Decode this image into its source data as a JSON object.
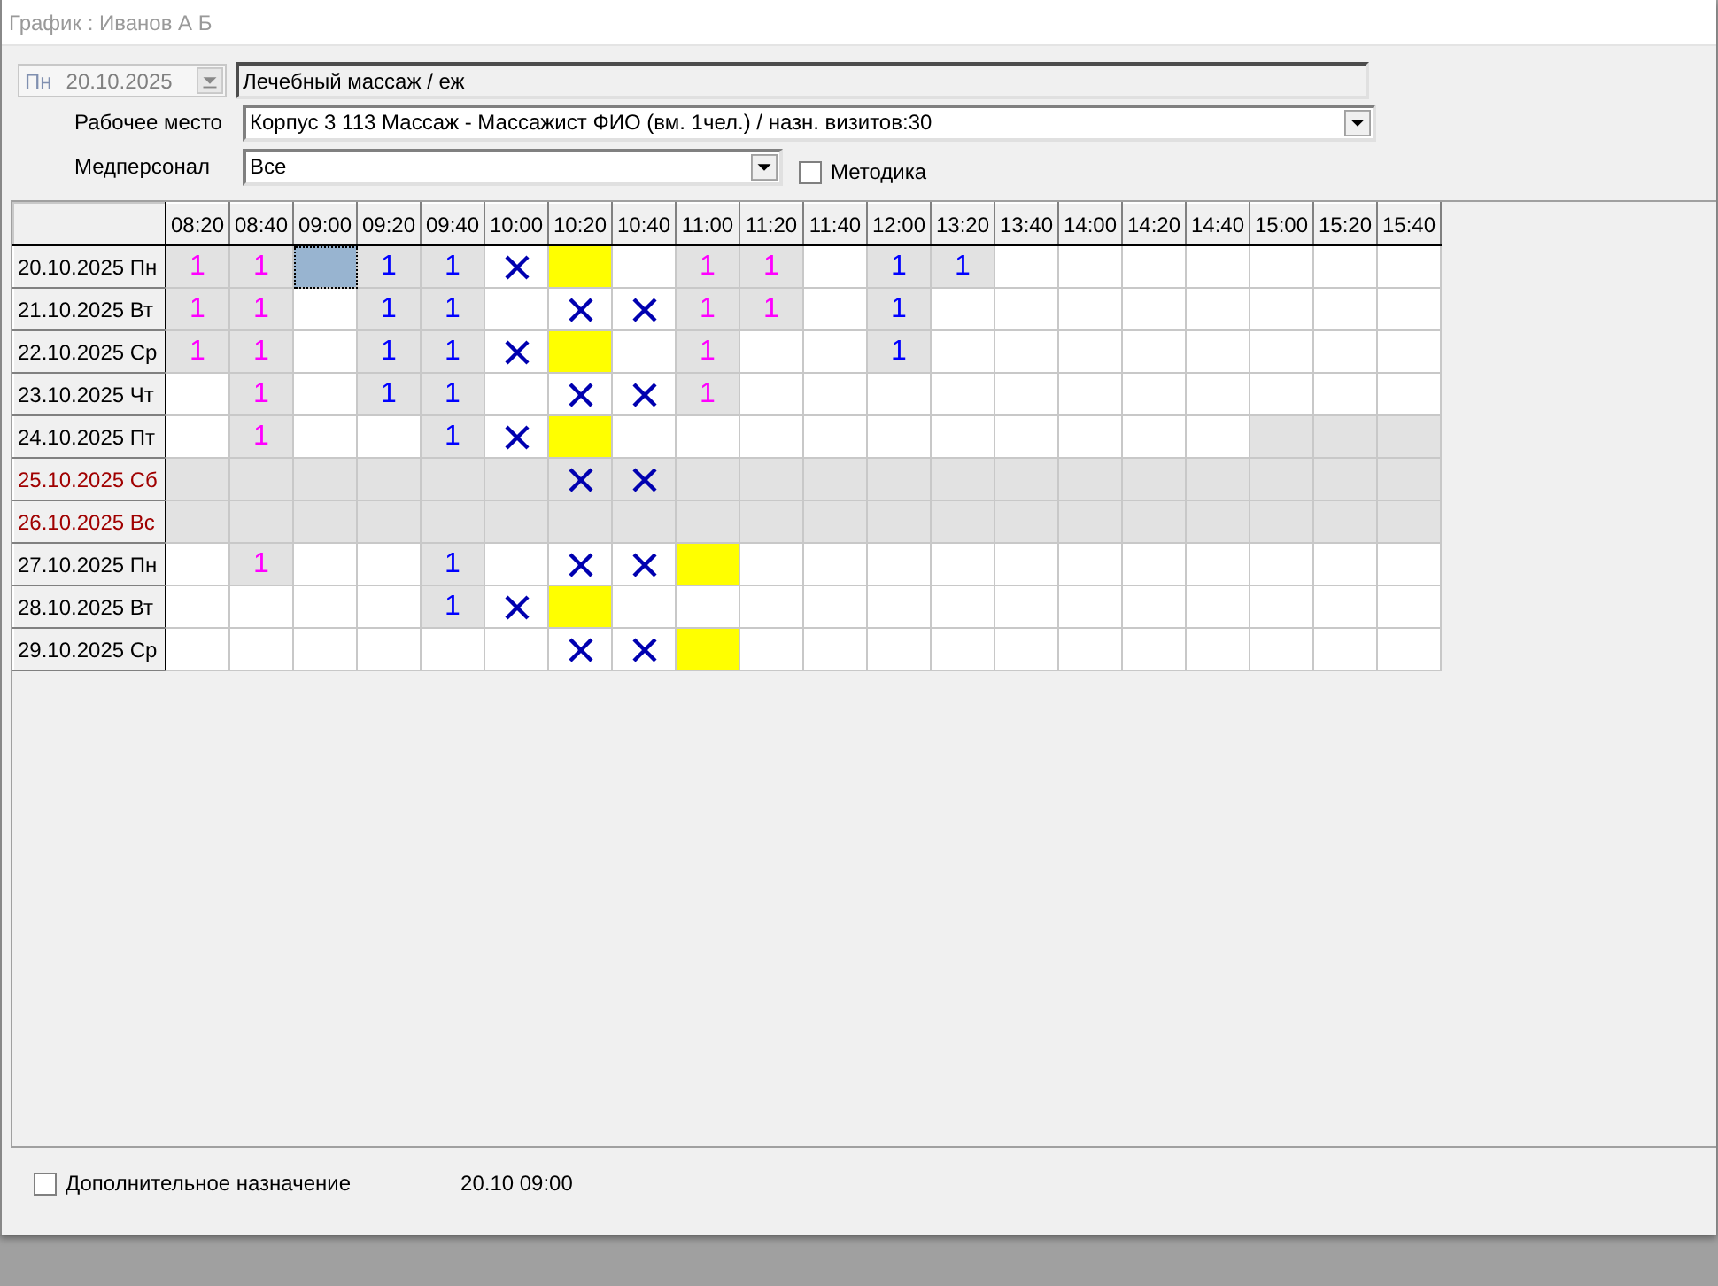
{
  "window": {
    "title": "График : Иванов А Б"
  },
  "date_picker": {
    "day": "Пн",
    "value": "20.10.2025",
    "disabled": true
  },
  "service_field": {
    "value": "Лечебный массаж / еж"
  },
  "workplace": {
    "label": "Рабочее место",
    "value": "Корпус 3 113 Массаж - Массажист ФИО  (вм. 1чел.) / назн. визитов:30"
  },
  "staff": {
    "label": "Медперсонал",
    "value": "Все"
  },
  "method_checkbox": {
    "label": "Методика",
    "checked": false
  },
  "grid": {
    "columns": [
      "08:20",
      "08:40",
      "09:00",
      "09:20",
      "09:40",
      "10:00",
      "10:20",
      "10:40",
      "11:00",
      "11:20",
      "11:40",
      "12:00",
      "13:20",
      "13:40",
      "14:00",
      "14:20",
      "14:40",
      "15:00",
      "15:20",
      "15:40"
    ],
    "rows": [
      {
        "date": "20.10.2025 Пн",
        "weekend": false,
        "cells": [
          {
            "kind": "count",
            "text": "1",
            "color": "#ff00ff",
            "shaded": true,
            "selected": false
          },
          {
            "kind": "count",
            "text": "1",
            "color": "#ff00ff",
            "shaded": true,
            "selected": false
          },
          {
            "kind": "free",
            "shaded": false,
            "selected": true
          },
          {
            "kind": "count",
            "text": "1",
            "color": "#0000ff",
            "shaded": true,
            "selected": false
          },
          {
            "kind": "count",
            "text": "1",
            "color": "#0000ff",
            "shaded": true,
            "selected": false
          },
          {
            "kind": "cross",
            "shaded": false,
            "selected": false
          },
          {
            "kind": "fill",
            "color": "#ffff00",
            "shaded": false,
            "selected": false
          },
          {
            "kind": "free",
            "shaded": false,
            "selected": false
          },
          {
            "kind": "count",
            "text": "1",
            "color": "#ff00ff",
            "shaded": true,
            "selected": false
          },
          {
            "kind": "count",
            "text": "1",
            "color": "#ff00ff",
            "shaded": true,
            "selected": false
          },
          {
            "kind": "free",
            "shaded": false,
            "selected": false
          },
          {
            "kind": "count",
            "text": "1",
            "color": "#0000ff",
            "shaded": true,
            "selected": false
          },
          {
            "kind": "count",
            "text": "1",
            "color": "#0000ff",
            "shaded": true,
            "selected": false
          },
          {
            "kind": "free",
            "shaded": false,
            "selected": false
          },
          {
            "kind": "free",
            "shaded": false,
            "selected": false
          },
          {
            "kind": "free",
            "shaded": false,
            "selected": false
          },
          {
            "kind": "free",
            "shaded": false,
            "selected": false
          },
          {
            "kind": "free",
            "shaded": false,
            "selected": false
          },
          {
            "kind": "free",
            "shaded": false,
            "selected": false
          },
          {
            "kind": "free",
            "shaded": false,
            "selected": false
          }
        ]
      },
      {
        "date": "21.10.2025 Вт",
        "weekend": false,
        "cells": [
          {
            "kind": "count",
            "text": "1",
            "color": "#ff00ff",
            "shaded": true,
            "selected": false
          },
          {
            "kind": "count",
            "text": "1",
            "color": "#ff00ff",
            "shaded": true,
            "selected": false
          },
          {
            "kind": "free",
            "shaded": false,
            "selected": false
          },
          {
            "kind": "count",
            "text": "1",
            "color": "#0000ff",
            "shaded": true,
            "selected": false
          },
          {
            "kind": "count",
            "text": "1",
            "color": "#0000ff",
            "shaded": true,
            "selected": false
          },
          {
            "kind": "free",
            "shaded": false,
            "selected": false
          },
          {
            "kind": "cross",
            "shaded": false,
            "selected": false
          },
          {
            "kind": "cross",
            "shaded": false,
            "selected": false
          },
          {
            "kind": "count",
            "text": "1",
            "color": "#ff00ff",
            "shaded": true,
            "selected": false
          },
          {
            "kind": "count",
            "text": "1",
            "color": "#ff00ff",
            "shaded": true,
            "selected": false
          },
          {
            "kind": "free",
            "shaded": false,
            "selected": false
          },
          {
            "kind": "count",
            "text": "1",
            "color": "#0000ff",
            "shaded": true,
            "selected": false
          },
          {
            "kind": "free",
            "shaded": false,
            "selected": false
          },
          {
            "kind": "free",
            "shaded": false,
            "selected": false
          },
          {
            "kind": "free",
            "shaded": false,
            "selected": false
          },
          {
            "kind": "free",
            "shaded": false,
            "selected": false
          },
          {
            "kind": "free",
            "shaded": false,
            "selected": false
          },
          {
            "kind": "free",
            "shaded": false,
            "selected": false
          },
          {
            "kind": "free",
            "shaded": false,
            "selected": false
          },
          {
            "kind": "free",
            "shaded": false,
            "selected": false
          }
        ]
      },
      {
        "date": "22.10.2025 Ср",
        "weekend": false,
        "cells": [
          {
            "kind": "count",
            "text": "1",
            "color": "#ff00ff",
            "shaded": true,
            "selected": false
          },
          {
            "kind": "count",
            "text": "1",
            "color": "#ff00ff",
            "shaded": true,
            "selected": false
          },
          {
            "kind": "free",
            "shaded": false,
            "selected": false
          },
          {
            "kind": "count",
            "text": "1",
            "color": "#0000ff",
            "shaded": true,
            "selected": false
          },
          {
            "kind": "count",
            "text": "1",
            "color": "#0000ff",
            "shaded": true,
            "selected": false
          },
          {
            "kind": "cross",
            "shaded": false,
            "selected": false
          },
          {
            "kind": "fill",
            "color": "#ffff00",
            "shaded": false,
            "selected": false
          },
          {
            "kind": "free",
            "shaded": false,
            "selected": false
          },
          {
            "kind": "count",
            "text": "1",
            "color": "#ff00ff",
            "shaded": true,
            "selected": false
          },
          {
            "kind": "free",
            "shaded": false,
            "selected": false
          },
          {
            "kind": "free",
            "shaded": false,
            "selected": false
          },
          {
            "kind": "count",
            "text": "1",
            "color": "#0000ff",
            "shaded": true,
            "selected": false
          },
          {
            "kind": "free",
            "shaded": false,
            "selected": false
          },
          {
            "kind": "free",
            "shaded": false,
            "selected": false
          },
          {
            "kind": "free",
            "shaded": false,
            "selected": false
          },
          {
            "kind": "free",
            "shaded": false,
            "selected": false
          },
          {
            "kind": "free",
            "shaded": false,
            "selected": false
          },
          {
            "kind": "free",
            "shaded": false,
            "selected": false
          },
          {
            "kind": "free",
            "shaded": false,
            "selected": false
          },
          {
            "kind": "free",
            "shaded": false,
            "selected": false
          }
        ]
      },
      {
        "date": "23.10.2025 Чт",
        "weekend": false,
        "cells": [
          {
            "kind": "free",
            "shaded": false,
            "selected": false
          },
          {
            "kind": "count",
            "text": "1",
            "color": "#ff00ff",
            "shaded": true,
            "selected": false
          },
          {
            "kind": "free",
            "shaded": false,
            "selected": false
          },
          {
            "kind": "count",
            "text": "1",
            "color": "#0000ff",
            "shaded": true,
            "selected": false
          },
          {
            "kind": "count",
            "text": "1",
            "color": "#0000ff",
            "shaded": true,
            "selected": false
          },
          {
            "kind": "free",
            "shaded": false,
            "selected": false
          },
          {
            "kind": "cross",
            "shaded": false,
            "selected": false
          },
          {
            "kind": "cross",
            "shaded": false,
            "selected": false
          },
          {
            "kind": "count",
            "text": "1",
            "color": "#ff00ff",
            "shaded": true,
            "selected": false
          },
          {
            "kind": "free",
            "shaded": false,
            "selected": false
          },
          {
            "kind": "free",
            "shaded": false,
            "selected": false
          },
          {
            "kind": "free",
            "shaded": false,
            "selected": false
          },
          {
            "kind": "free",
            "shaded": false,
            "selected": false
          },
          {
            "kind": "free",
            "shaded": false,
            "selected": false
          },
          {
            "kind": "free",
            "shaded": false,
            "selected": false
          },
          {
            "kind": "free",
            "shaded": false,
            "selected": false
          },
          {
            "kind": "free",
            "shaded": false,
            "selected": false
          },
          {
            "kind": "free",
            "shaded": false,
            "selected": false
          },
          {
            "kind": "free",
            "shaded": false,
            "selected": false
          },
          {
            "kind": "free",
            "shaded": false,
            "selected": false
          }
        ]
      },
      {
        "date": "24.10.2025 Пт",
        "weekend": false,
        "cells": [
          {
            "kind": "free",
            "shaded": false,
            "selected": false
          },
          {
            "kind": "count",
            "text": "1",
            "color": "#ff00ff",
            "shaded": true,
            "selected": false
          },
          {
            "kind": "free",
            "shaded": false,
            "selected": false
          },
          {
            "kind": "free",
            "shaded": false,
            "selected": false
          },
          {
            "kind": "count",
            "text": "1",
            "color": "#0000ff",
            "shaded": true,
            "selected": false
          },
          {
            "kind": "cross",
            "shaded": false,
            "selected": false
          },
          {
            "kind": "fill",
            "color": "#ffff00",
            "shaded": false,
            "selected": false
          },
          {
            "kind": "free",
            "shaded": false,
            "selected": false
          },
          {
            "kind": "free",
            "shaded": false,
            "selected": false
          },
          {
            "kind": "free",
            "shaded": false,
            "selected": false
          },
          {
            "kind": "free",
            "shaded": false,
            "selected": false
          },
          {
            "kind": "free",
            "shaded": false,
            "selected": false
          },
          {
            "kind": "free",
            "shaded": false,
            "selected": false
          },
          {
            "kind": "free",
            "shaded": false,
            "selected": false
          },
          {
            "kind": "free",
            "shaded": false,
            "selected": false
          },
          {
            "kind": "free",
            "shaded": false,
            "selected": false
          },
          {
            "kind": "free",
            "shaded": false,
            "selected": false
          },
          {
            "kind": "free",
            "shaded": true,
            "selected": false
          },
          {
            "kind": "free",
            "shaded": true,
            "selected": false
          },
          {
            "kind": "free",
            "shaded": true,
            "selected": false
          }
        ]
      },
      {
        "date": "25.10.2025 Сб",
        "weekend": true,
        "cells": [
          {
            "kind": "free",
            "shaded": true,
            "selected": false
          },
          {
            "kind": "free",
            "shaded": true,
            "selected": false
          },
          {
            "kind": "free",
            "shaded": true,
            "selected": false
          },
          {
            "kind": "free",
            "shaded": true,
            "selected": false
          },
          {
            "kind": "free",
            "shaded": true,
            "selected": false
          },
          {
            "kind": "free",
            "shaded": true,
            "selected": false
          },
          {
            "kind": "cross",
            "shaded": true,
            "selected": false
          },
          {
            "kind": "cross",
            "shaded": true,
            "selected": false
          },
          {
            "kind": "free",
            "shaded": true,
            "selected": false
          },
          {
            "kind": "free",
            "shaded": true,
            "selected": false
          },
          {
            "kind": "free",
            "shaded": true,
            "selected": false
          },
          {
            "kind": "free",
            "shaded": true,
            "selected": false
          },
          {
            "kind": "free",
            "shaded": true,
            "selected": false
          },
          {
            "kind": "free",
            "shaded": true,
            "selected": false
          },
          {
            "kind": "free",
            "shaded": true,
            "selected": false
          },
          {
            "kind": "free",
            "shaded": true,
            "selected": false
          },
          {
            "kind": "free",
            "shaded": true,
            "selected": false
          },
          {
            "kind": "free",
            "shaded": true,
            "selected": false
          },
          {
            "kind": "free",
            "shaded": true,
            "selected": false
          },
          {
            "kind": "free",
            "shaded": true,
            "selected": false
          }
        ]
      },
      {
        "date": "26.10.2025 Вс",
        "weekend": true,
        "cells": [
          {
            "kind": "free",
            "shaded": true,
            "selected": false
          },
          {
            "kind": "free",
            "shaded": true,
            "selected": false
          },
          {
            "kind": "free",
            "shaded": true,
            "selected": false
          },
          {
            "kind": "free",
            "shaded": true,
            "selected": false
          },
          {
            "kind": "free",
            "shaded": true,
            "selected": false
          },
          {
            "kind": "free",
            "shaded": true,
            "selected": false
          },
          {
            "kind": "free",
            "shaded": true,
            "selected": false
          },
          {
            "kind": "free",
            "shaded": true,
            "selected": false
          },
          {
            "kind": "free",
            "shaded": true,
            "selected": false
          },
          {
            "kind": "free",
            "shaded": true,
            "selected": false
          },
          {
            "kind": "free",
            "shaded": true,
            "selected": false
          },
          {
            "kind": "free",
            "shaded": true,
            "selected": false
          },
          {
            "kind": "free",
            "shaded": true,
            "selected": false
          },
          {
            "kind": "free",
            "shaded": true,
            "selected": false
          },
          {
            "kind": "free",
            "shaded": true,
            "selected": false
          },
          {
            "kind": "free",
            "shaded": true,
            "selected": false
          },
          {
            "kind": "free",
            "shaded": true,
            "selected": false
          },
          {
            "kind": "free",
            "shaded": true,
            "selected": false
          },
          {
            "kind": "free",
            "shaded": true,
            "selected": false
          },
          {
            "kind": "free",
            "shaded": true,
            "selected": false
          }
        ]
      },
      {
        "date": "27.10.2025 Пн",
        "weekend": false,
        "cells": [
          {
            "kind": "free",
            "shaded": false,
            "selected": false
          },
          {
            "kind": "count",
            "text": "1",
            "color": "#ff00ff",
            "shaded": true,
            "selected": false
          },
          {
            "kind": "free",
            "shaded": false,
            "selected": false
          },
          {
            "kind": "free",
            "shaded": false,
            "selected": false
          },
          {
            "kind": "count",
            "text": "1",
            "color": "#0000ff",
            "shaded": true,
            "selected": false
          },
          {
            "kind": "free",
            "shaded": false,
            "selected": false
          },
          {
            "kind": "cross",
            "shaded": false,
            "selected": false
          },
          {
            "kind": "cross",
            "shaded": false,
            "selected": false
          },
          {
            "kind": "fill",
            "color": "#ffff00",
            "shaded": false,
            "selected": false
          },
          {
            "kind": "free",
            "shaded": false,
            "selected": false
          },
          {
            "kind": "free",
            "shaded": false,
            "selected": false
          },
          {
            "kind": "free",
            "shaded": false,
            "selected": false
          },
          {
            "kind": "free",
            "shaded": false,
            "selected": false
          },
          {
            "kind": "free",
            "shaded": false,
            "selected": false
          },
          {
            "kind": "free",
            "shaded": false,
            "selected": false
          },
          {
            "kind": "free",
            "shaded": false,
            "selected": false
          },
          {
            "kind": "free",
            "shaded": false,
            "selected": false
          },
          {
            "kind": "free",
            "shaded": false,
            "selected": false
          },
          {
            "kind": "free",
            "shaded": false,
            "selected": false
          },
          {
            "kind": "free",
            "shaded": false,
            "selected": false
          }
        ]
      },
      {
        "date": "28.10.2025 Вт",
        "weekend": false,
        "cells": [
          {
            "kind": "free",
            "shaded": false,
            "selected": false
          },
          {
            "kind": "free",
            "shaded": false,
            "selected": false
          },
          {
            "kind": "free",
            "shaded": false,
            "selected": false
          },
          {
            "kind": "free",
            "shaded": false,
            "selected": false
          },
          {
            "kind": "count",
            "text": "1",
            "color": "#0000ff",
            "shaded": true,
            "selected": false
          },
          {
            "kind": "cross",
            "shaded": false,
            "selected": false
          },
          {
            "kind": "fill",
            "color": "#ffff00",
            "shaded": false,
            "selected": false
          },
          {
            "kind": "free",
            "shaded": false,
            "selected": false
          },
          {
            "kind": "free",
            "shaded": false,
            "selected": false
          },
          {
            "kind": "free",
            "shaded": false,
            "selected": false
          },
          {
            "kind": "free",
            "shaded": false,
            "selected": false
          },
          {
            "kind": "free",
            "shaded": false,
            "selected": false
          },
          {
            "kind": "free",
            "shaded": false,
            "selected": false
          },
          {
            "kind": "free",
            "shaded": false,
            "selected": false
          },
          {
            "kind": "free",
            "shaded": false,
            "selected": false
          },
          {
            "kind": "free",
            "shaded": false,
            "selected": false
          },
          {
            "kind": "free",
            "shaded": false,
            "selected": false
          },
          {
            "kind": "free",
            "shaded": false,
            "selected": false
          },
          {
            "kind": "free",
            "shaded": false,
            "selected": false
          },
          {
            "kind": "free",
            "shaded": false,
            "selected": false
          }
        ]
      },
      {
        "date": "29.10.2025 Ср",
        "weekend": false,
        "cells": [
          {
            "kind": "free",
            "shaded": false,
            "selected": false
          },
          {
            "kind": "free",
            "shaded": false,
            "selected": false
          },
          {
            "kind": "free",
            "shaded": false,
            "selected": false
          },
          {
            "kind": "free",
            "shaded": false,
            "selected": false
          },
          {
            "kind": "free",
            "shaded": false,
            "selected": false
          },
          {
            "kind": "free",
            "shaded": false,
            "selected": false
          },
          {
            "kind": "cross",
            "shaded": false,
            "selected": false
          },
          {
            "kind": "cross",
            "shaded": false,
            "selected": false
          },
          {
            "kind": "fill",
            "color": "#ffff00",
            "shaded": false,
            "selected": false
          },
          {
            "kind": "free",
            "shaded": false,
            "selected": false
          },
          {
            "kind": "free",
            "shaded": false,
            "selected": false
          },
          {
            "kind": "free",
            "shaded": false,
            "selected": false
          },
          {
            "kind": "free",
            "shaded": false,
            "selected": false
          },
          {
            "kind": "free",
            "shaded": false,
            "selected": false
          },
          {
            "kind": "free",
            "shaded": false,
            "selected": false
          },
          {
            "kind": "free",
            "shaded": false,
            "selected": false
          },
          {
            "kind": "free",
            "shaded": false,
            "selected": false
          },
          {
            "kind": "free",
            "shaded": false,
            "selected": false
          },
          {
            "kind": "free",
            "shaded": false,
            "selected": false
          },
          {
            "kind": "free",
            "shaded": false,
            "selected": false
          }
        ]
      }
    ]
  },
  "extra_checkbox": {
    "label": "Дополнительное назначение",
    "checked": false
  },
  "status_text": "20.10 09:00"
}
